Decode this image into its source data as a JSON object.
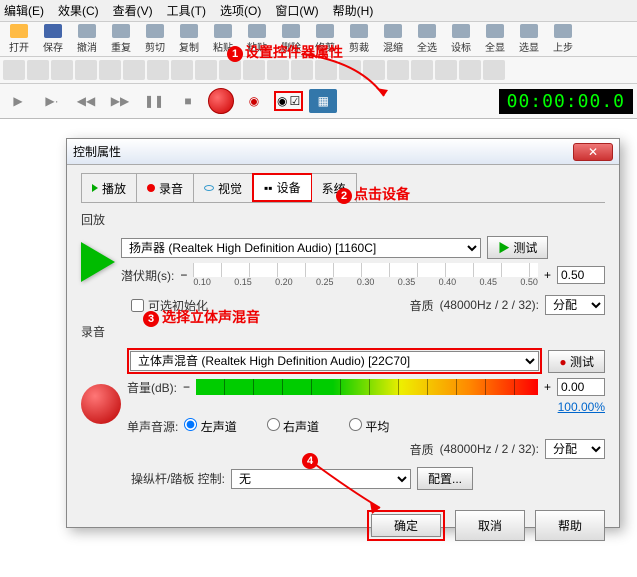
{
  "menu": [
    "编辑(E)",
    "效果(C)",
    "查看(V)",
    "工具(T)",
    "选项(O)",
    "窗口(W)",
    "帮助(H)"
  ],
  "toolbar": [
    "打开",
    "保存",
    "撤消",
    "重复",
    "剪切",
    "复制",
    "粘贴",
    "粘贴",
    "删除",
    "修剪",
    "剪裁",
    "混缩",
    "全选",
    "设标",
    "全显",
    "选显",
    "上步"
  ],
  "timecode": "00:00:00.0",
  "callouts": {
    "c1": "1",
    "c1text": "设置控件器属性",
    "c2": "2",
    "c2text": "点击设备",
    "c3": "3",
    "c3text": "选择立体声混音",
    "c4": "4"
  },
  "dialog": {
    "title": "控制属性",
    "tabs": {
      "play": "播放",
      "record": "录音",
      "visual": "视觉",
      "device": "设备",
      "system": "系统"
    },
    "playback": {
      "label": "回放",
      "device": "扬声器 (Realtek High Definition Audio) [1160C]",
      "test": "测试",
      "latency_label": "潜伏期(s):",
      "latency": "0.50",
      "ruler": [
        "0.10",
        "0.15",
        "0.20",
        "0.25",
        "0.30",
        "0.35",
        "0.40",
        "0.45",
        "0.50"
      ],
      "optinit": "可选初始化",
      "quality_label": "音质",
      "quality_val": "(48000Hz / 2 / 32):",
      "alloc": "分配"
    },
    "record": {
      "label": "录音",
      "device": "立体声混音 (Realtek High Definition Audio) [22C70]",
      "test": "测试",
      "vol_label": "音量(dB):",
      "vol": "0.00",
      "pct": "100.00%",
      "mono_label": "单声音源:",
      "left": "左声道",
      "right": "右声道",
      "avg": "平均",
      "quality_label": "音质",
      "quality_val": "(48000Hz / 2 / 32):",
      "alloc": "分配"
    },
    "joystick": {
      "label": "操纵杆/踏板 控制:",
      "value": "无",
      "config": "配置..."
    },
    "buttons": {
      "ok": "确定",
      "cancel": "取消",
      "help": "帮助"
    }
  }
}
